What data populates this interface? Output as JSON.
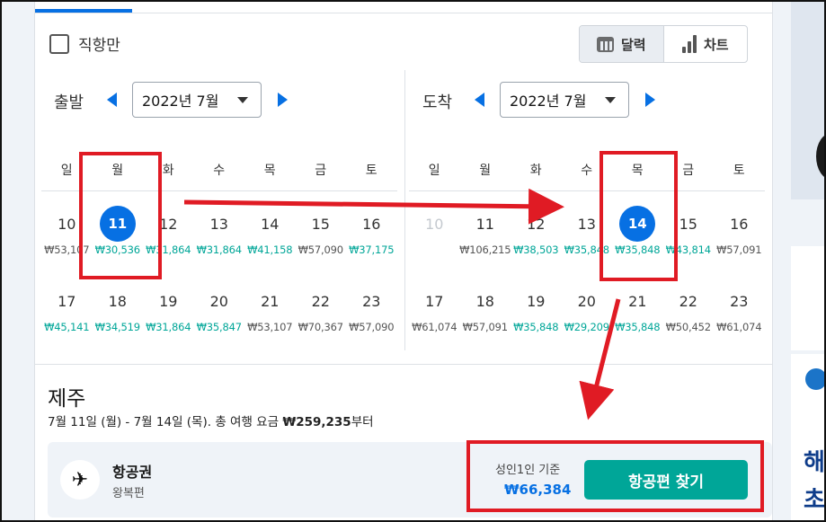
{
  "filters": {
    "direct_only_label": "직항만"
  },
  "view_toggle": {
    "calendar_label": "달력",
    "chart_label": "차트"
  },
  "departure": {
    "label": "출발",
    "month": "2022년 7월"
  },
  "arrival": {
    "label": "도착",
    "month": "2022년 7월"
  },
  "weekdays": [
    "일",
    "월",
    "화",
    "수",
    "목",
    "금",
    "토"
  ],
  "departure_calendar": {
    "weeks": [
      [
        {
          "day": "10",
          "price": "₩53,107",
          "cheap": false,
          "selected": false,
          "disabled": false
        },
        {
          "day": "11",
          "price": "₩30,536",
          "cheap": true,
          "selected": true,
          "disabled": false
        },
        {
          "day": "12",
          "price": "₩31,864",
          "cheap": true,
          "selected": false,
          "disabled": false
        },
        {
          "day": "13",
          "price": "₩31,864",
          "cheap": true,
          "selected": false,
          "disabled": false
        },
        {
          "day": "14",
          "price": "₩41,158",
          "cheap": true,
          "selected": false,
          "disabled": false
        },
        {
          "day": "15",
          "price": "₩57,090",
          "cheap": false,
          "selected": false,
          "disabled": false
        },
        {
          "day": "16",
          "price": "₩37,175",
          "cheap": true,
          "selected": false,
          "disabled": false
        }
      ],
      [
        {
          "day": "17",
          "price": "₩45,141",
          "cheap": true,
          "selected": false,
          "disabled": false
        },
        {
          "day": "18",
          "price": "₩34,519",
          "cheap": true,
          "selected": false,
          "disabled": false
        },
        {
          "day": "19",
          "price": "₩31,864",
          "cheap": true,
          "selected": false,
          "disabled": false
        },
        {
          "day": "20",
          "price": "₩35,847",
          "cheap": true,
          "selected": false,
          "disabled": false
        },
        {
          "day": "21",
          "price": "₩53,107",
          "cheap": false,
          "selected": false,
          "disabled": false
        },
        {
          "day": "22",
          "price": "₩70,367",
          "cheap": false,
          "selected": false,
          "disabled": false
        },
        {
          "day": "23",
          "price": "₩57,090",
          "cheap": false,
          "selected": false,
          "disabled": false
        }
      ]
    ]
  },
  "arrival_calendar": {
    "weeks": [
      [
        {
          "day": "10",
          "price": "",
          "cheap": false,
          "selected": false,
          "disabled": true
        },
        {
          "day": "11",
          "price": "₩106,215",
          "cheap": false,
          "selected": false,
          "disabled": false
        },
        {
          "day": "12",
          "price": "₩38,503",
          "cheap": true,
          "selected": false,
          "disabled": false
        },
        {
          "day": "13",
          "price": "₩35,848",
          "cheap": true,
          "selected": false,
          "disabled": false
        },
        {
          "day": "14",
          "price": "₩35,848",
          "cheap": true,
          "selected": true,
          "disabled": false
        },
        {
          "day": "15",
          "price": "₩43,814",
          "cheap": true,
          "selected": false,
          "disabled": false
        },
        {
          "day": "16",
          "price": "₩57,091",
          "cheap": false,
          "selected": false,
          "disabled": false
        }
      ],
      [
        {
          "day": "17",
          "price": "₩61,074",
          "cheap": false,
          "selected": false,
          "disabled": false
        },
        {
          "day": "18",
          "price": "₩57,091",
          "cheap": false,
          "selected": false,
          "disabled": false
        },
        {
          "day": "19",
          "price": "₩35,848",
          "cheap": true,
          "selected": false,
          "disabled": false
        },
        {
          "day": "20",
          "price": "₩29,209",
          "cheap": true,
          "selected": false,
          "disabled": false
        },
        {
          "day": "21",
          "price": "₩35,848",
          "cheap": true,
          "selected": false,
          "disabled": false
        },
        {
          "day": "22",
          "price": "₩50,452",
          "cheap": false,
          "selected": false,
          "disabled": false
        },
        {
          "day": "23",
          "price": "₩61,074",
          "cheap": false,
          "selected": false,
          "disabled": false
        }
      ]
    ]
  },
  "destination": {
    "name": "제주",
    "summary_prefix": "7월 11일 (월) - 7월 14일 (목). 총 여행 요금 ",
    "summary_price": "₩259,235",
    "summary_suffix": "부터"
  },
  "flight": {
    "title": "항공권",
    "subtitle": "왕복편",
    "basis": "성인1인 기준",
    "price": "₩66,384",
    "search_label": "항공편 찾기"
  },
  "side_panel": {
    "text_1": "해",
    "text_2": "초"
  },
  "colors": {
    "accent": "#0770e3",
    "cheap": "#00a698",
    "annotation": "#e01b24"
  }
}
